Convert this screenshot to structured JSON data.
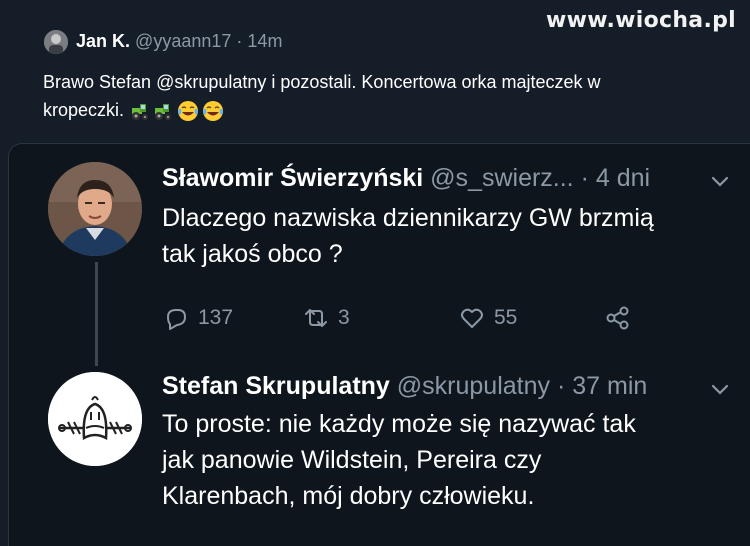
{
  "watermark": "www.wiocha.pl",
  "outer_tweet": {
    "name": "Jan K.",
    "handle": "@yyaann17",
    "separator": "·",
    "time": "14m",
    "text_line1": "Brawo Stefan @skrupulatny  i pozostali. Koncertowa orka  majteczek w",
    "text_line2": "kropeczki.",
    "emojis": [
      "tractor",
      "tractor",
      "face-with-tears-of-joy",
      "face-with-tears-of-joy"
    ]
  },
  "quoted_tweet": {
    "name": "Sławomir Świerzyński",
    "handle": "@s_swierz...",
    "separator": "·",
    "time": "4 dni",
    "text_line1": "Dlaczego nazwiska dziennikarzy GW brzmią",
    "text_line2": "tak jakoś obco ?",
    "replies": "137",
    "retweets": "3",
    "likes": "55"
  },
  "reply_tweet": {
    "name": "Stefan Skrupulatny",
    "handle": "@skrupulatny",
    "separator": "·",
    "time": "37 min",
    "text_line1": "To proste: nie każdy może się nazywać tak",
    "text_line2": "jak panowie Wildstein, Pereira czy",
    "text_line3": "Klarenbach, mój dobry człowieku."
  },
  "colors": {
    "background": "#151d28",
    "card": "#0f151c",
    "muted": "#8b98a5",
    "text": "#ffffff"
  }
}
